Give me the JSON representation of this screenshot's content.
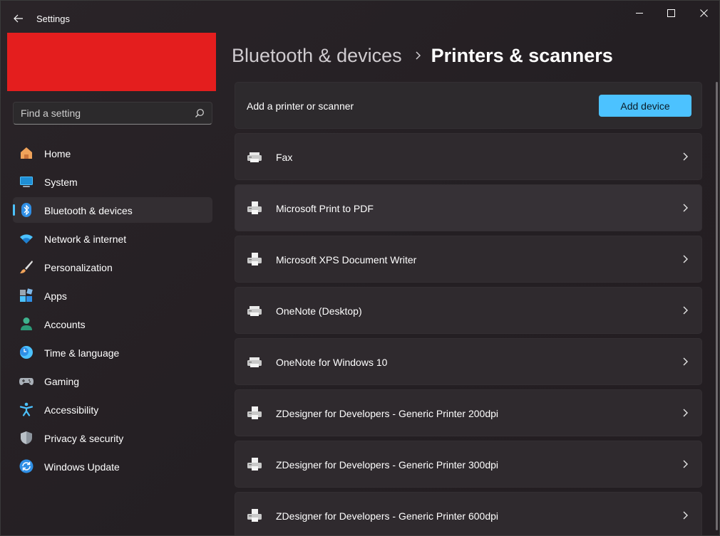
{
  "window": {
    "title": "Settings",
    "controls": {
      "minimize": "minimize-icon",
      "maximize": "maximize-icon",
      "close": "close-icon"
    }
  },
  "search": {
    "placeholder": "Find a setting"
  },
  "sidebar": {
    "items": [
      {
        "label": "Home",
        "icon": "home-icon"
      },
      {
        "label": "System",
        "icon": "monitor-icon"
      },
      {
        "label": "Bluetooth & devices",
        "icon": "bluetooth-icon",
        "active": true
      },
      {
        "label": "Network & internet",
        "icon": "wifi-icon"
      },
      {
        "label": "Personalization",
        "icon": "brush-icon"
      },
      {
        "label": "Apps",
        "icon": "apps-icon"
      },
      {
        "label": "Accounts",
        "icon": "person-icon"
      },
      {
        "label": "Time & language",
        "icon": "clock-globe-icon"
      },
      {
        "label": "Gaming",
        "icon": "gamepad-icon"
      },
      {
        "label": "Accessibility",
        "icon": "accessibility-icon"
      },
      {
        "label": "Privacy & security",
        "icon": "shield-icon"
      },
      {
        "label": "Windows Update",
        "icon": "update-icon"
      }
    ]
  },
  "breadcrumb": {
    "parent": "Bluetooth & devices",
    "current": "Printers & scanners"
  },
  "add_card": {
    "label": "Add a printer or scanner",
    "button": "Add device"
  },
  "printers": [
    {
      "name": "Fax"
    },
    {
      "name": "Microsoft Print to PDF"
    },
    {
      "name": "Microsoft XPS Document Writer"
    },
    {
      "name": "OneNote (Desktop)"
    },
    {
      "name": "OneNote for Windows 10"
    },
    {
      "name": "ZDesigner for Developers - Generic Printer 200dpi"
    },
    {
      "name": "ZDesigner for Developers - Generic Printer 300dpi"
    },
    {
      "name": "ZDesigner for Developers - Generic Printer 600dpi"
    }
  ],
  "colors": {
    "accent": "#4cc2ff",
    "account_block": "#e41e1e"
  }
}
